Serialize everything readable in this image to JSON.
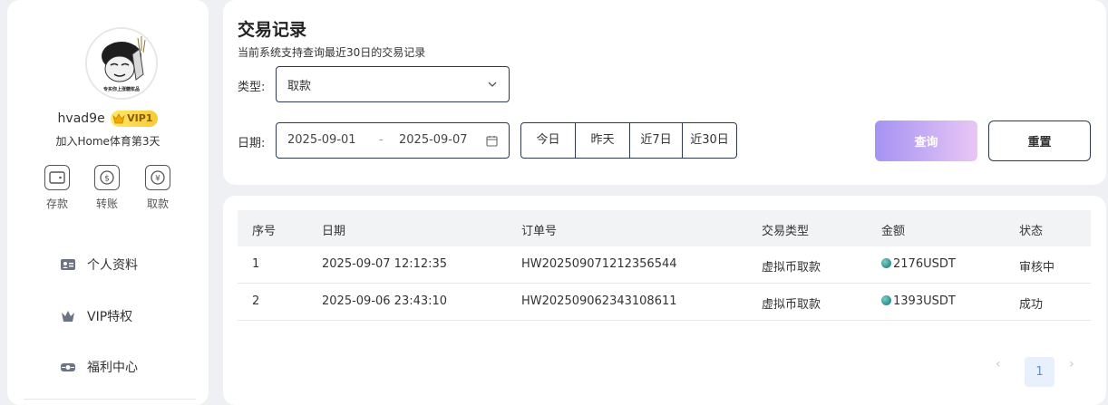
{
  "sidebar": {
    "avatar_caption": "专买你上涨糖浆品",
    "username": "hvad9e",
    "vip_label": "VIP1",
    "join_text": "加入Home体育第3天",
    "quick_actions": [
      {
        "icon": "wallet-icon",
        "label": "存款"
      },
      {
        "icon": "transfer-icon",
        "label": "转账"
      },
      {
        "icon": "yen-icon",
        "label": "取款"
      }
    ],
    "menu": [
      {
        "icon": "id-card-icon",
        "label": "个人资料"
      },
      {
        "icon": "crown-icon",
        "label": "VIP特权"
      },
      {
        "icon": "gift-icon",
        "label": "福利中心"
      }
    ]
  },
  "filter": {
    "title": "交易记录",
    "subtitle": "当前系统支持查询最近30日的交易记录",
    "type_label": "类型:",
    "type_value": "取款",
    "date_label": "日期:",
    "date_start": "2025-09-01",
    "date_sep": "-",
    "date_end": "2025-09-07",
    "quick_ranges": [
      "今日",
      "昨天",
      "近7日",
      "近30日"
    ],
    "query_label": "查询",
    "reset_label": "重置"
  },
  "table": {
    "columns": [
      "序号",
      "日期",
      "订单号",
      "交易类型",
      "金额",
      "状态"
    ],
    "rows": [
      {
        "no": "1",
        "date": "2025-09-07 12:12:35",
        "order": "HW202509071212356544",
        "type": "虚拟币取款",
        "amount": "2176USDT",
        "status": "审核中"
      },
      {
        "no": "2",
        "date": "2025-09-06 23:43:10",
        "order": "HW202509062343108611",
        "type": "虚拟币取款",
        "amount": "1393USDT",
        "status": "成功"
      }
    ]
  },
  "pagination": {
    "prev": "‹",
    "current": "1",
    "next": "›"
  },
  "colors": {
    "accent_start": "#a593f3",
    "accent_end": "#e9c6f4",
    "vip_gold": "#f7c934",
    "page_active_bg": "#e8f1fb"
  }
}
